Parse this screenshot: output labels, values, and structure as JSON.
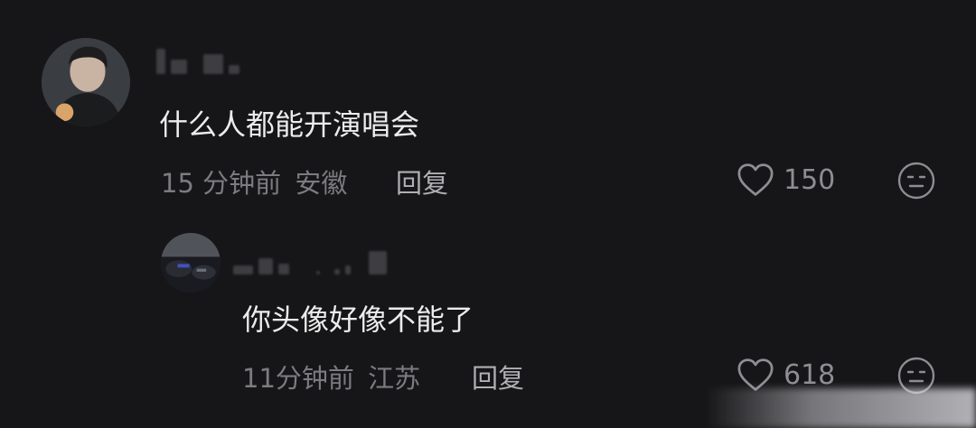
{
  "comment": {
    "text": "什么人都能开演唱会",
    "time": "15 分钟前",
    "location": "安徽",
    "reply_label": "回复",
    "like_count": "150"
  },
  "reply": {
    "text": "你头像好像不能了",
    "time": "11分钟前",
    "location": "江苏",
    "reply_label": "回复",
    "like_count": "618"
  },
  "icons": {
    "like": "heart-outline-icon",
    "dislike": "neutral-face-icon"
  },
  "colors": {
    "background": "#161618",
    "primary_text": "#ececec",
    "meta_text": "#7b7b80"
  }
}
